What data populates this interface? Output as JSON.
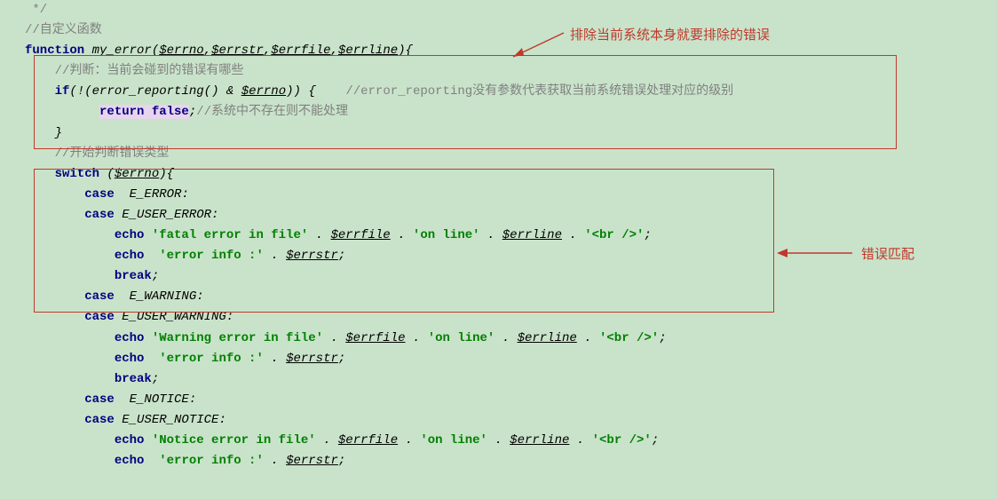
{
  "code": {
    "l1": " */",
    "l2_c": "//自定义函数",
    "l3_kw1": "function",
    "l3_fn": " my_error",
    "l3_p1": "(",
    "l3_v1": "$errno",
    "l3_c1": ",",
    "l3_v2": "$errstr",
    "l3_c2": ",",
    "l3_v3": "$errfile",
    "l3_c3": ",",
    "l3_v4": "$errline",
    "l3_p2": "){",
    "l4_c": "    //判断：当前会碰到的错误有哪些",
    "l5_kw": "    if",
    "l5_t1": "(!(",
    "l5_fn": "error_reporting",
    "l5_t2": "() & ",
    "l5_v": "$errno",
    "l5_t3": ")) {    ",
    "l5_c": "//error_reporting没有参数代表获取当前系统错误处理对应的级别",
    "l6_pad": "          ",
    "l6_kw": "return false",
    "l6_t": ";",
    "l6_c": "//系统中不存在则不能处理",
    "l7": "    }",
    "l8": "",
    "l9_c": "    //开始判断错误类型",
    "l10_kw": "    switch ",
    "l10_t1": "(",
    "l10_v": "$errno",
    "l10_t2": "){",
    "l11_kw": "        case  ",
    "l11_c": "E_ERROR",
    "l11_t": ":",
    "l12_kw": "        case ",
    "l12_c": "E_USER_ERROR",
    "l12_t": ":",
    "l13_kw": "            echo ",
    "l13_s1": "'fatal error in file'",
    "l13_t1": " . ",
    "l13_v1": "$errfile",
    "l13_t2": " . ",
    "l13_s2": "'on line'",
    "l13_t3": " . ",
    "l13_v2": "$errline",
    "l13_t4": " . ",
    "l13_s3": "'<br />'",
    "l13_t5": ";",
    "l14_kw": "            echo  ",
    "l14_s": "'error info :'",
    "l14_t1": " . ",
    "l14_v": "$errstr",
    "l14_t2": ";",
    "l15_kw": "            break",
    "l15_t": ";",
    "l16_kw": "        case  ",
    "l16_c": "E_WARNING",
    "l16_t": ":",
    "l17_kw": "        case ",
    "l17_c": "E_USER_WARNING",
    "l17_t": ":",
    "l18_kw": "            echo ",
    "l18_s1": "'Warning error in file'",
    "l18_t1": " . ",
    "l18_v1": "$errfile",
    "l18_t2": " . ",
    "l18_s2": "'on line'",
    "l18_t3": " . ",
    "l18_v2": "$errline",
    "l18_t4": " . ",
    "l18_s3": "'<br />'",
    "l18_t5": ";",
    "l19_kw": "            echo  ",
    "l19_s": "'error info :'",
    "l19_t1": " . ",
    "l19_v": "$errstr",
    "l19_t2": ";",
    "l20_kw": "            break",
    "l20_t": ";",
    "l21_kw": "        case  ",
    "l21_c": "E_NOTICE",
    "l21_t": ":",
    "l22_kw": "        case ",
    "l22_c": "E_USER_NOTICE",
    "l22_t": ":",
    "l23_kw": "            echo ",
    "l23_s1": "'Notice error in file'",
    "l23_t1": " . ",
    "l23_v1": "$errfile",
    "l23_t2": " . ",
    "l23_s2": "'on line'",
    "l23_t3": " . ",
    "l23_v2": "$errline",
    "l23_t4": " . ",
    "l23_s3": "'<br />'",
    "l23_t5": ";",
    "l24_kw": "            echo  ",
    "l24_s": "'error info :'",
    "l24_t1": " . ",
    "l24_v": "$errstr",
    "l24_t2": ";"
  },
  "annotations": {
    "top": "排除当前系统本身就要排除的错误",
    "right": "错误匹配"
  }
}
